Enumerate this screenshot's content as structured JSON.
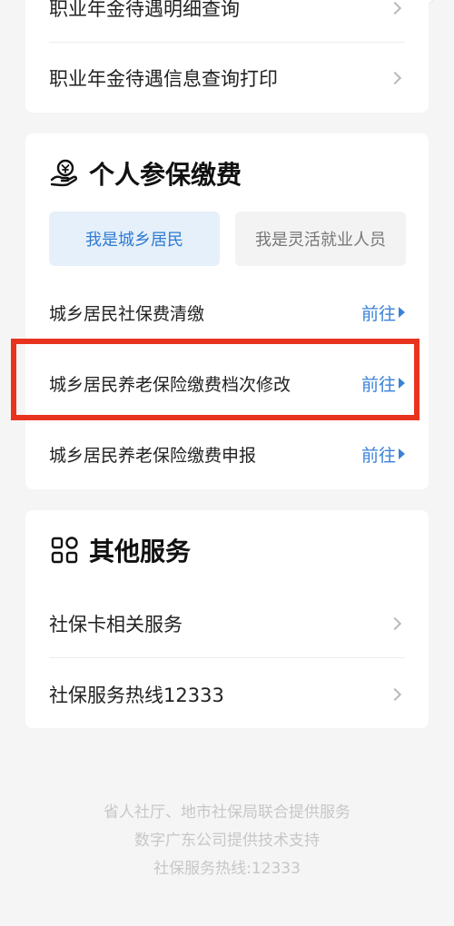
{
  "card_top": {
    "rows": [
      {
        "label": "职业年金待遇明细查询"
      },
      {
        "label": "职业年金待遇信息查询打印"
      }
    ]
  },
  "personal": {
    "title": "个人参保缴费",
    "tabs": [
      {
        "label": "我是城乡居民",
        "active": true
      },
      {
        "label": "我是灵活就业人员",
        "active": false
      }
    ],
    "items": [
      {
        "label": "城乡居民社保费清缴",
        "action": "前往"
      },
      {
        "label": "城乡居民养老保险缴费档次修改",
        "action": "前往"
      },
      {
        "label": "城乡居民养老保险缴费申报",
        "action": "前往"
      }
    ]
  },
  "other": {
    "title": "其他服务",
    "rows": [
      {
        "label": "社保卡相关服务"
      },
      {
        "label": "社保服务热线12333"
      }
    ]
  },
  "footer": {
    "lines": [
      "省人社厅、地市社保局联合提供服务",
      "数字广东公司提供技术支持",
      "社保服务热线:12333"
    ]
  },
  "colors": {
    "accent": "#3a82d8",
    "highlight": "#e8341e",
    "background": "#f5f5f5"
  }
}
